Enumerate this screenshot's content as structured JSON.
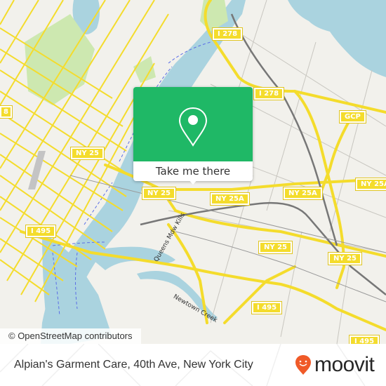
{
  "map": {
    "attribution": "© OpenStreetMap contributors",
    "road_shields": [
      {
        "label": "I 278"
      },
      {
        "label": "I 278"
      },
      {
        "label": "GCP"
      },
      {
        "label": "8"
      },
      {
        "label": "NY 25"
      },
      {
        "label": "NY 25"
      },
      {
        "label": "NY 25A"
      },
      {
        "label": "NY 25A"
      },
      {
        "label": "NY 25A"
      },
      {
        "label": "I 495"
      },
      {
        "label": "NY 25"
      },
      {
        "label": "NY 25"
      },
      {
        "label": "I 495"
      },
      {
        "label": "I 495"
      }
    ],
    "street_labels": [
      {
        "label": "Queens Mdw Kills"
      },
      {
        "label": "Newtown Creek"
      }
    ],
    "colors": {
      "land": "#f2f1ec",
      "water": "#aad3df",
      "park": "#cde8b0",
      "road_major": "#f4dc2c",
      "rail": "#777777"
    }
  },
  "popup": {
    "icon": "map-pin-icon",
    "cta_label": "Take me there",
    "color": "#1fb866"
  },
  "footer": {
    "place_name": "Alpian's Garment Care, 40th Ave, New York City",
    "logo_text": "moovit",
    "logo_icon": "moovit-pin-smile-icon",
    "logo_color": "#f05a28"
  }
}
